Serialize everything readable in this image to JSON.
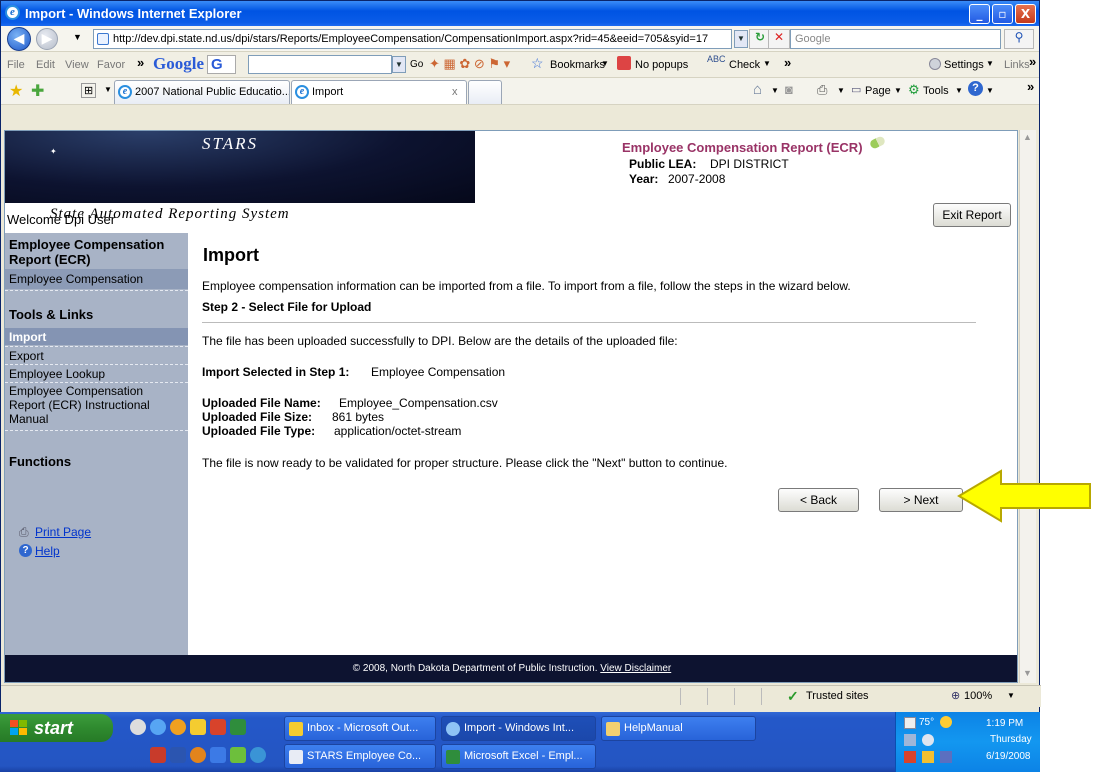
{
  "window": {
    "title": "Import - Windows Internet Explorer",
    "minimize": "_",
    "maximize": "▫",
    "close": "X"
  },
  "nav": {
    "back": "◀",
    "forward": "▶",
    "address": "http://dev.dpi.state.nd.us/dpi/stars/Reports/EmployeeCompensation/CompensationImport.aspx?rid=45&eeid=705&syid=17",
    "search_placeholder": "Google",
    "refresh": "↻",
    "stop": "✕"
  },
  "menubar": {
    "items": [
      "File",
      "Edit",
      "View",
      "Favor"
    ],
    "more": "»",
    "google_logo": "Google",
    "google_g": "G",
    "go": "Go",
    "bookmarks": "Bookmarks",
    "popups": "No popups",
    "check": "Check",
    "more2": "»",
    "settings": "Settings",
    "links": "Links",
    "more3": "»"
  },
  "tabs": [
    {
      "label": "2007 National Public Educatio..."
    },
    {
      "label": "Import"
    }
  ],
  "tab_close": "x",
  "commandbar": {
    "page": "Page",
    "tools": "Tools",
    "more": "»"
  },
  "header": {
    "stars": "STARS",
    "subtitle": "State Automated Reporting System",
    "report_title": "Employee Compensation Report (ECR)",
    "lea_label": "Public LEA:",
    "lea_value": "DPI DISTRICT",
    "year_label": "Year:",
    "year_value": "2007-2008",
    "welcome": "Welcome Dpi User",
    "exit_button": "Exit Report"
  },
  "sidebar": {
    "section1_title": "Employee Compensation Report (ECR)",
    "section1_items": [
      "Employee Compensation"
    ],
    "section2_title": "Tools & Links",
    "section2_items": [
      "Import",
      "Export",
      "Employee Lookup",
      "Employee Compensation Report (ECR) Instructional Manual"
    ],
    "section3_title": "Functions",
    "print_page": "Print Page",
    "help": "Help"
  },
  "main": {
    "title": "Import",
    "intro": "Employee compensation information can be imported from a file. To import from a file, follow the steps in the wizard below.",
    "step_title": "Step 2 - Select File for Upload",
    "uploaded_msg": "The file has been uploaded successfully to DPI. Below are the details of the uploaded file:",
    "import_selected_label": "Import Selected in Step 1:",
    "import_selected_value": "Employee Compensation",
    "file_name_label": "Uploaded File Name:",
    "file_name_value": "Employee_Compensation.csv",
    "file_size_label": "Uploaded File Size:",
    "file_size_value": "861 bytes",
    "file_type_label": "Uploaded File Type:",
    "file_type_value": "application/octet-stream",
    "ready_msg": "The file is now ready to be validated for proper structure. Please click the \"Next\" button to continue.",
    "back_button": "< Back",
    "next_button": "> Next"
  },
  "footer": {
    "copyright": "© 2008, North Dakota Department of Public Instruction.",
    "disclaimer": "View Disclaimer"
  },
  "statusbar": {
    "zone": "Trusted sites",
    "zoom": "100%"
  },
  "taskbar": {
    "start": "start",
    "buttons": [
      "Inbox - Microsoft Out...",
      "Import - Windows Int...",
      "HelpManual",
      "STARS Employee Co...",
      "Microsoft Excel - Empl..."
    ],
    "temp": "75°",
    "time": "1:19 PM",
    "day": "Thursday",
    "date": "6/19/2008"
  },
  "colors": {
    "report_title": "#993366",
    "sidebar_bg": "#a8b3c6",
    "banner_bg": "#0d1330",
    "arrow": "#ffff00"
  }
}
